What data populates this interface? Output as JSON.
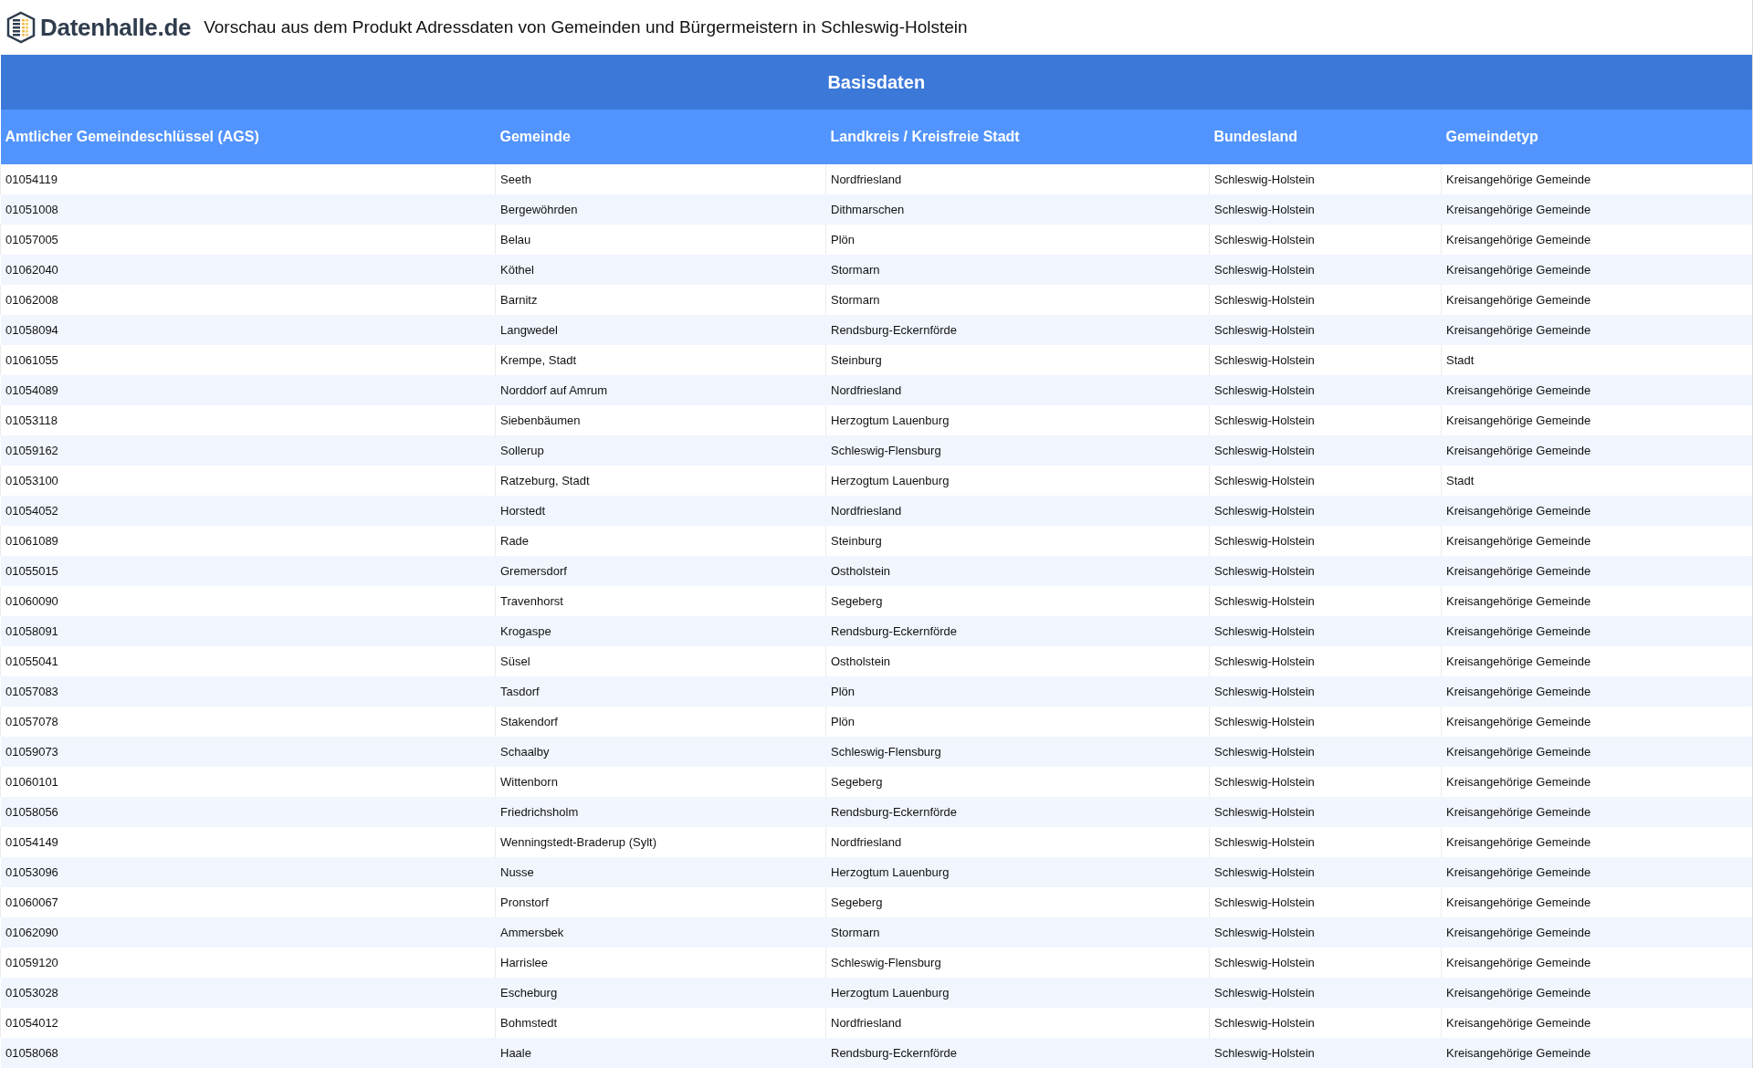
{
  "header": {
    "logo_text": "Datenhalle.de",
    "title": "Vorschau aus dem Produkt Adressdaten von Gemeinden und Bürgermeistern in Schleswig-Holstein"
  },
  "table": {
    "title": "Basisdaten",
    "columns": [
      "Amtlicher Gemeindeschlüssel (AGS)",
      "Gemeinde",
      "Landkreis / Kreisfreie Stadt",
      "Bundesland",
      "Gemeindetyp"
    ],
    "rows": [
      [
        "01054119",
        "Seeth",
        "Nordfriesland",
        "Schleswig-Holstein",
        "Kreisangehörige Gemeinde"
      ],
      [
        "01051008",
        "Bergewöhrden",
        "Dithmarschen",
        "Schleswig-Holstein",
        "Kreisangehörige Gemeinde"
      ],
      [
        "01057005",
        "Belau",
        "Plön",
        "Schleswig-Holstein",
        "Kreisangehörige Gemeinde"
      ],
      [
        "01062040",
        "Köthel",
        "Stormarn",
        "Schleswig-Holstein",
        "Kreisangehörige Gemeinde"
      ],
      [
        "01062008",
        "Barnitz",
        "Stormarn",
        "Schleswig-Holstein",
        "Kreisangehörige Gemeinde"
      ],
      [
        "01058094",
        "Langwedel",
        "Rendsburg-Eckernförde",
        "Schleswig-Holstein",
        "Kreisangehörige Gemeinde"
      ],
      [
        "01061055",
        "Krempe, Stadt",
        "Steinburg",
        "Schleswig-Holstein",
        "Stadt"
      ],
      [
        "01054089",
        "Norddorf auf Amrum",
        "Nordfriesland",
        "Schleswig-Holstein",
        "Kreisangehörige Gemeinde"
      ],
      [
        "01053118",
        "Siebenbäumen",
        "Herzogtum Lauenburg",
        "Schleswig-Holstein",
        "Kreisangehörige Gemeinde"
      ],
      [
        "01059162",
        "Sollerup",
        "Schleswig-Flensburg",
        "Schleswig-Holstein",
        "Kreisangehörige Gemeinde"
      ],
      [
        "01053100",
        "Ratzeburg, Stadt",
        "Herzogtum Lauenburg",
        "Schleswig-Holstein",
        "Stadt"
      ],
      [
        "01054052",
        "Horstedt",
        "Nordfriesland",
        "Schleswig-Holstein",
        "Kreisangehörige Gemeinde"
      ],
      [
        "01061089",
        "Rade",
        "Steinburg",
        "Schleswig-Holstein",
        "Kreisangehörige Gemeinde"
      ],
      [
        "01055015",
        "Gremersdorf",
        "Ostholstein",
        "Schleswig-Holstein",
        "Kreisangehörige Gemeinde"
      ],
      [
        "01060090",
        "Travenhorst",
        "Segeberg",
        "Schleswig-Holstein",
        "Kreisangehörige Gemeinde"
      ],
      [
        "01058091",
        "Krogaspe",
        "Rendsburg-Eckernförde",
        "Schleswig-Holstein",
        "Kreisangehörige Gemeinde"
      ],
      [
        "01055041",
        "Süsel",
        "Ostholstein",
        "Schleswig-Holstein",
        "Kreisangehörige Gemeinde"
      ],
      [
        "01057083",
        "Tasdorf",
        "Plön",
        "Schleswig-Holstein",
        "Kreisangehörige Gemeinde"
      ],
      [
        "01057078",
        "Stakendorf",
        "Plön",
        "Schleswig-Holstein",
        "Kreisangehörige Gemeinde"
      ],
      [
        "01059073",
        "Schaalby",
        "Schleswig-Flensburg",
        "Schleswig-Holstein",
        "Kreisangehörige Gemeinde"
      ],
      [
        "01060101",
        "Wittenborn",
        "Segeberg",
        "Schleswig-Holstein",
        "Kreisangehörige Gemeinde"
      ],
      [
        "01058056",
        "Friedrichsholm",
        "Rendsburg-Eckernförde",
        "Schleswig-Holstein",
        "Kreisangehörige Gemeinde"
      ],
      [
        "01054149",
        "Wenningstedt-Braderup (Sylt)",
        "Nordfriesland",
        "Schleswig-Holstein",
        "Kreisangehörige Gemeinde"
      ],
      [
        "01053096",
        "Nusse",
        "Herzogtum Lauenburg",
        "Schleswig-Holstein",
        "Kreisangehörige Gemeinde"
      ],
      [
        "01060067",
        "Pronstorf",
        "Segeberg",
        "Schleswig-Holstein",
        "Kreisangehörige Gemeinde"
      ],
      [
        "01062090",
        "Ammersbek",
        "Stormarn",
        "Schleswig-Holstein",
        "Kreisangehörige Gemeinde"
      ],
      [
        "01059120",
        "Harrislee",
        "Schleswig-Flensburg",
        "Schleswig-Holstein",
        "Kreisangehörige Gemeinde"
      ],
      [
        "01053028",
        "Escheburg",
        "Herzogtum Lauenburg",
        "Schleswig-Holstein",
        "Kreisangehörige Gemeinde"
      ],
      [
        "01054012",
        "Bohmstedt",
        "Nordfriesland",
        "Schleswig-Holstein",
        "Kreisangehörige Gemeinde"
      ],
      [
        "01058068",
        "Haale",
        "Rendsburg-Eckernförde",
        "Schleswig-Holstein",
        "Kreisangehörige Gemeinde"
      ]
    ]
  }
}
